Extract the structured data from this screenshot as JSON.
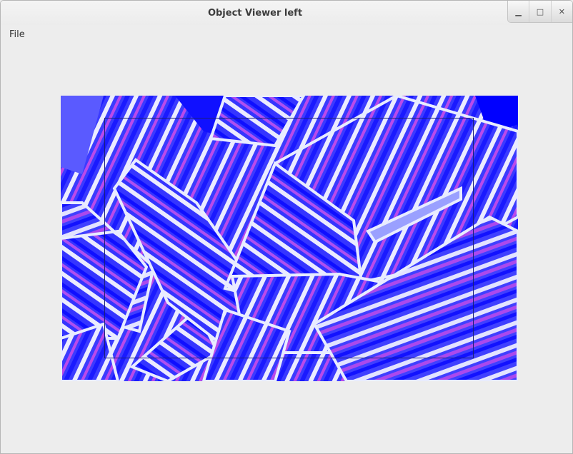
{
  "window": {
    "title": "Object Viewer left"
  },
  "controls": {
    "minimize_icon": "minimize-icon",
    "maximize_icon": "maximize-icon",
    "close_icon": "close-icon"
  },
  "menu": {
    "items": [
      {
        "label": "File"
      }
    ]
  },
  "image": {
    "base_color": "#3333ff",
    "stripe_colors": [
      "#4a4aff",
      "#ffffff",
      "#d94de6",
      "#0000ff"
    ],
    "edge_color": "#e8ecff"
  }
}
